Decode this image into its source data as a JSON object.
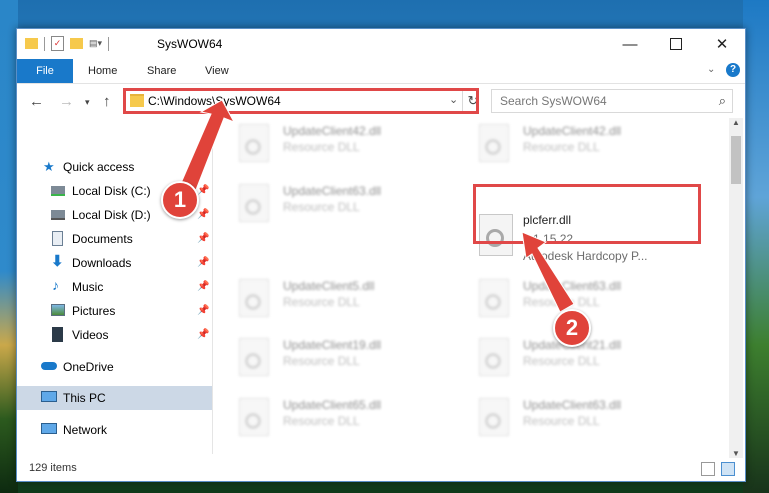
{
  "window": {
    "title": "SysWOW64",
    "minimize_icon": "minimize-icon",
    "maximize_icon": "maximize-icon",
    "close_icon": "close-icon"
  },
  "ribbon": {
    "tabs": [
      {
        "label": "File"
      },
      {
        "label": "Home"
      },
      {
        "label": "Share"
      },
      {
        "label": "View"
      }
    ],
    "help_icon": "help-icon"
  },
  "address": {
    "path": "C:\\Windows\\SysWOW64"
  },
  "search": {
    "placeholder": "Search SysWOW64"
  },
  "nav": {
    "items": [
      {
        "label": "Quick access",
        "icon": "star-icon"
      },
      {
        "label": "Local Disk (C:)",
        "icon": "drive-icon",
        "pinned": true
      },
      {
        "label": "Local Disk (D:)",
        "icon": "drive-icon",
        "pinned": true
      },
      {
        "label": "Documents",
        "icon": "documents-icon",
        "pinned": true
      },
      {
        "label": "Downloads",
        "icon": "download-icon",
        "pinned": true
      },
      {
        "label": "Music",
        "icon": "music-icon",
        "pinned": true
      },
      {
        "label": "Pictures",
        "icon": "pictures-icon",
        "pinned": true
      },
      {
        "label": "Videos",
        "icon": "videos-icon",
        "pinned": true
      },
      {
        "label": "OneDrive",
        "icon": "cloud-icon"
      },
      {
        "label": "This PC",
        "icon": "computer-icon",
        "selected": true
      },
      {
        "label": "Network",
        "icon": "network-icon"
      }
    ]
  },
  "files": [
    {
      "name": "UpdateClient42.dll",
      "desc": "Resource DLL"
    },
    {
      "name": "UpdateClient42.dll",
      "desc": "Resource DLL"
    },
    {
      "name": "UpdateClient63.dll",
      "desc": "Resource DLL"
    },
    {
      "name": "plcferr.dll",
      "version": "7.1.15.22",
      "desc": "Autodesk Hardcopy P..."
    },
    {
      "name": "UpdateClient5.dll",
      "desc": "Resource DLL"
    },
    {
      "name": "UpdateClient63.dll",
      "desc": "Resource DLL"
    },
    {
      "name": "UpdateClient19.dll",
      "desc": "Resource DLL"
    },
    {
      "name": "UpdateClient21.dll",
      "desc": "Resource DLL"
    },
    {
      "name": "UpdateClient65.dll",
      "desc": "Resource DLL"
    },
    {
      "name": "UpdateClient63.dll",
      "desc": "Resource DLL"
    }
  ],
  "status": {
    "item_count": "129 items"
  },
  "annotations": {
    "badge1": "1",
    "badge2": "2",
    "color": "#e0433a"
  }
}
